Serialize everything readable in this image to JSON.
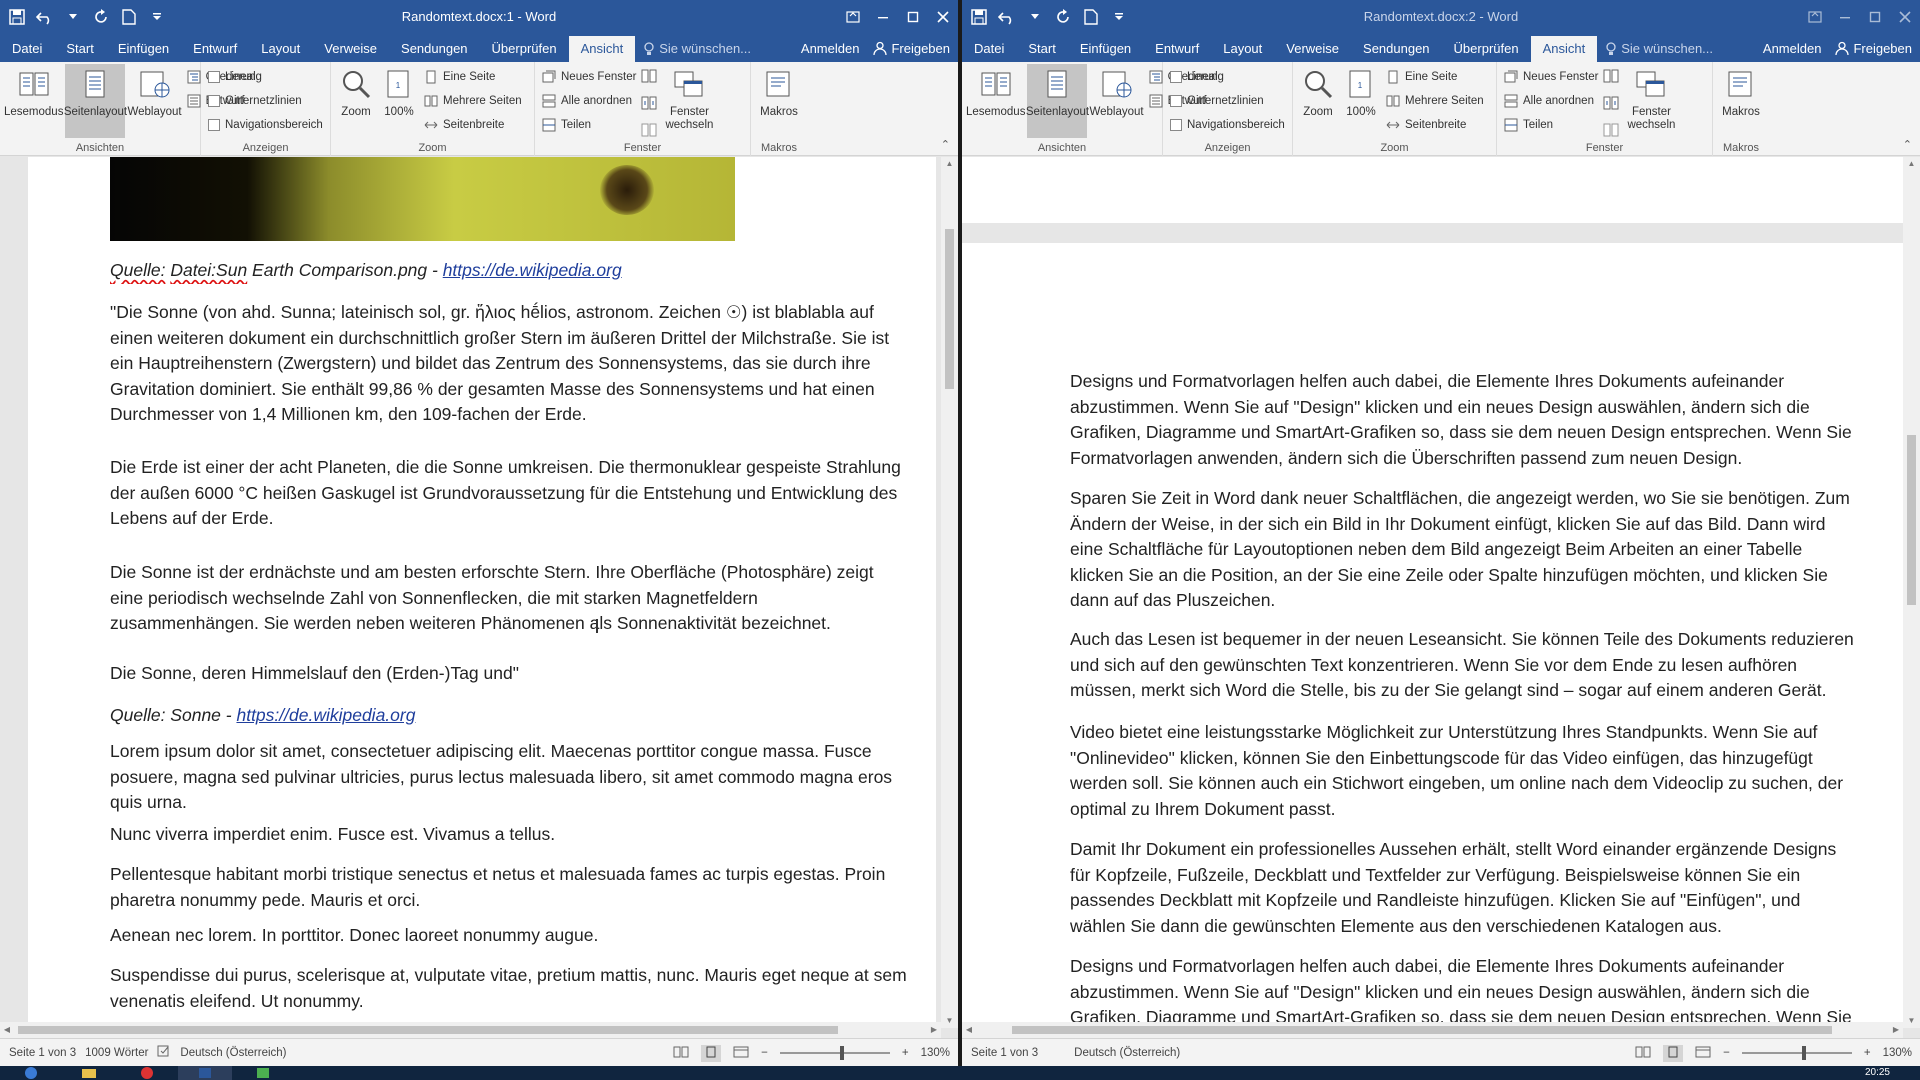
{
  "left_window": {
    "title": "Randomtext.docx:1 - Word",
    "status_page": "Seite 1 von 3",
    "status_words": "1009 Wörter",
    "status_language": "Deutsch (Österreich)",
    "zoom": "130%"
  },
  "right_window": {
    "title": "Randomtext.docx:2 - Word",
    "status_page": "Seite 1 von 3",
    "status_language": "Deutsch (Österreich)",
    "zoom": "130%"
  },
  "tabs": [
    "Datei",
    "Start",
    "Einfügen",
    "Entwurf",
    "Layout",
    "Verweise",
    "Sendungen",
    "Überprüfen",
    "Ansicht"
  ],
  "tell_me": "Sie wünschen...",
  "sign_in": "Anmelden",
  "share": "Freigeben",
  "ribbon": {
    "ansichten": {
      "label": "Ansichten",
      "lesemodus": "Lesemodus",
      "seitenlayout": "Seitenlayout",
      "weblayout": "Weblayout",
      "gliederung": "Gliederung",
      "entwurf": "Entwurf"
    },
    "anzeigen": {
      "label": "Anzeigen",
      "lineal": "Lineal",
      "gitternetz": "Gitternetzlinien",
      "navigation": "Navigationsbereich"
    },
    "zoom": {
      "label": "Zoom",
      "zoom": "Zoom",
      "hundert": "100%",
      "eine_seite": "Eine Seite",
      "mehrere": "Mehrere Seiten",
      "seitenbreite": "Seitenbreite"
    },
    "fenster": {
      "label": "Fenster",
      "neues": "Neues Fenster",
      "alle": "Alle anordnen",
      "teilen": "Teilen",
      "wechseln_1": "Fenster",
      "wechseln_2": "wechseln"
    },
    "makros": {
      "label": "Makros",
      "makros": "Makros"
    }
  },
  "left_doc": {
    "cap1_prefix": "Quelle:",
    "cap1_file": "Datei:Sun",
    "cap1_rest": " Earth Comparison.png - ",
    "cap1_link": "https://de.wikipedia.org",
    "p1": "\"Die Sonne (von ahd. Sunna; lateinisch sol, gr. ἥλιος hḗlios, astronom. Zeichen ☉) ist blablabla auf einen weiteren dokument ein durchschnittlich großer Stern im äußeren Drittel der Milchstraße. Sie ist ein Hauptreihenstern (Zwergstern) und bildet das Zentrum des Sonnensystems, das sie durch ihre Gravitation dominiert. Sie enthält 99,86 % der gesamten Masse des Sonnensystems und hat einen Durchmesser von 1,4 Millionen km, den 109-fachen der Erde.",
    "p2": "Die Erde ist einer der acht Planeten, die die Sonne umkreisen. Die thermonuklear gespeiste Strahlung der außen 6000 °C heißen Gaskugel ist Grundvoraussetzung für die Entstehung und Entwicklung des Lebens auf der Erde.",
    "p3": "Die Sonne ist der erdnächste und am besten erforschte Stern. Ihre Oberfläche (Photosphäre) zeigt eine periodisch wechselnde Zahl von Sonnenflecken, die mit starken Magnetfeldern zusammenhängen. Sie werden neben weiteren Phänomenen als Sonnenaktivität bezeichnet.",
    "p4": "Die Sonne, deren Himmelslauf den (Erden-)Tag und\"",
    "cap2_prefix": "Quelle: Sonne - ",
    "cap2_link": "https://de.wikipedia.org",
    "p5": "Lorem ipsum dolor sit amet, consectetuer adipiscing elit. Maecenas porttitor congue massa. Fusce posuere, magna sed pulvinar ultricies, purus lectus malesuada libero, sit amet commodo magna eros quis urna.",
    "p6": "Nunc viverra imperdiet enim. Fusce est. Vivamus a tellus.",
    "p7": "Pellentesque habitant morbi tristique senectus et netus et malesuada fames ac turpis egestas. Proin pharetra nonummy pede. Mauris et orci.",
    "p8": "Aenean nec lorem. In porttitor. Donec laoreet nonummy augue.",
    "p9": "Suspendisse dui purus, scelerisque at, vulputate vitae, pretium mattis, nunc. Mauris eget neque at sem venenatis eleifend. Ut nonummy."
  },
  "right_doc": {
    "p1": "Designs und Formatvorlagen helfen auch dabei, die Elemente Ihres Dokuments aufeinander abzustimmen. Wenn Sie auf \"Design\" klicken und ein neues Design auswählen, ändern sich die Grafiken, Diagramme und SmartArt-Grafiken so, dass sie dem neuen Design entsprechen. Wenn Sie Formatvorlagen anwenden, ändern sich die Überschriften passend zum neuen Design.",
    "p2": "Sparen Sie Zeit in Word dank neuer Schaltflächen, die angezeigt werden, wo Sie sie benötigen. Zum Ändern der Weise, in der sich ein Bild in Ihr Dokument einfügt, klicken Sie auf das Bild. Dann wird eine Schaltfläche für Layoutoptionen neben dem Bild angezeigt Beim Arbeiten an einer Tabelle klicken Sie an die Position, an der Sie eine Zeile oder Spalte hinzufügen möchten, und klicken Sie dann auf das Pluszeichen.",
    "p3": "Auch das Lesen ist bequemer in der neuen Leseansicht. Sie können Teile des Dokuments reduzieren und sich auf den gewünschten Text konzentrieren. Wenn Sie vor dem Ende zu lesen aufhören müssen, merkt sich Word die Stelle, bis zu der Sie gelangt sind – sogar auf einem anderen Gerät.",
    "p4": "Video bietet eine leistungsstarke Möglichkeit zur Unterstützung Ihres Standpunkts. Wenn Sie auf \"Onlinevideo\" klicken, können Sie den Einbettungscode für das Video einfügen, das hinzugefügt werden soll. Sie können auch ein Stichwort eingeben, um online nach dem Videoclip zu suchen, der optimal zu Ihrem Dokument passt.",
    "p5": "Damit Ihr Dokument ein professionelles Aussehen erhält, stellt Word einander ergänzende Designs für Kopfzeile, Fußzeile, Deckblatt und Textfelder zur Verfügung. Beispielsweise können Sie ein passendes Deckblatt mit Kopfzeile und Randleiste hinzufügen. Klicken Sie auf \"Einfügen\", und wählen Sie dann die gewünschten Elemente aus den verschiedenen Katalogen aus.",
    "p6": "Designs und Formatvorlagen helfen auch dabei, die Elemente Ihres Dokuments aufeinander abzustimmen. Wenn Sie auf \"Design\" klicken und ein neues Design auswählen, ändern sich die Grafiken, Diagramme und SmartArt-Grafiken so, dass sie dem neuen Design entsprechen. Wenn Sie"
  },
  "clock": "20:25"
}
